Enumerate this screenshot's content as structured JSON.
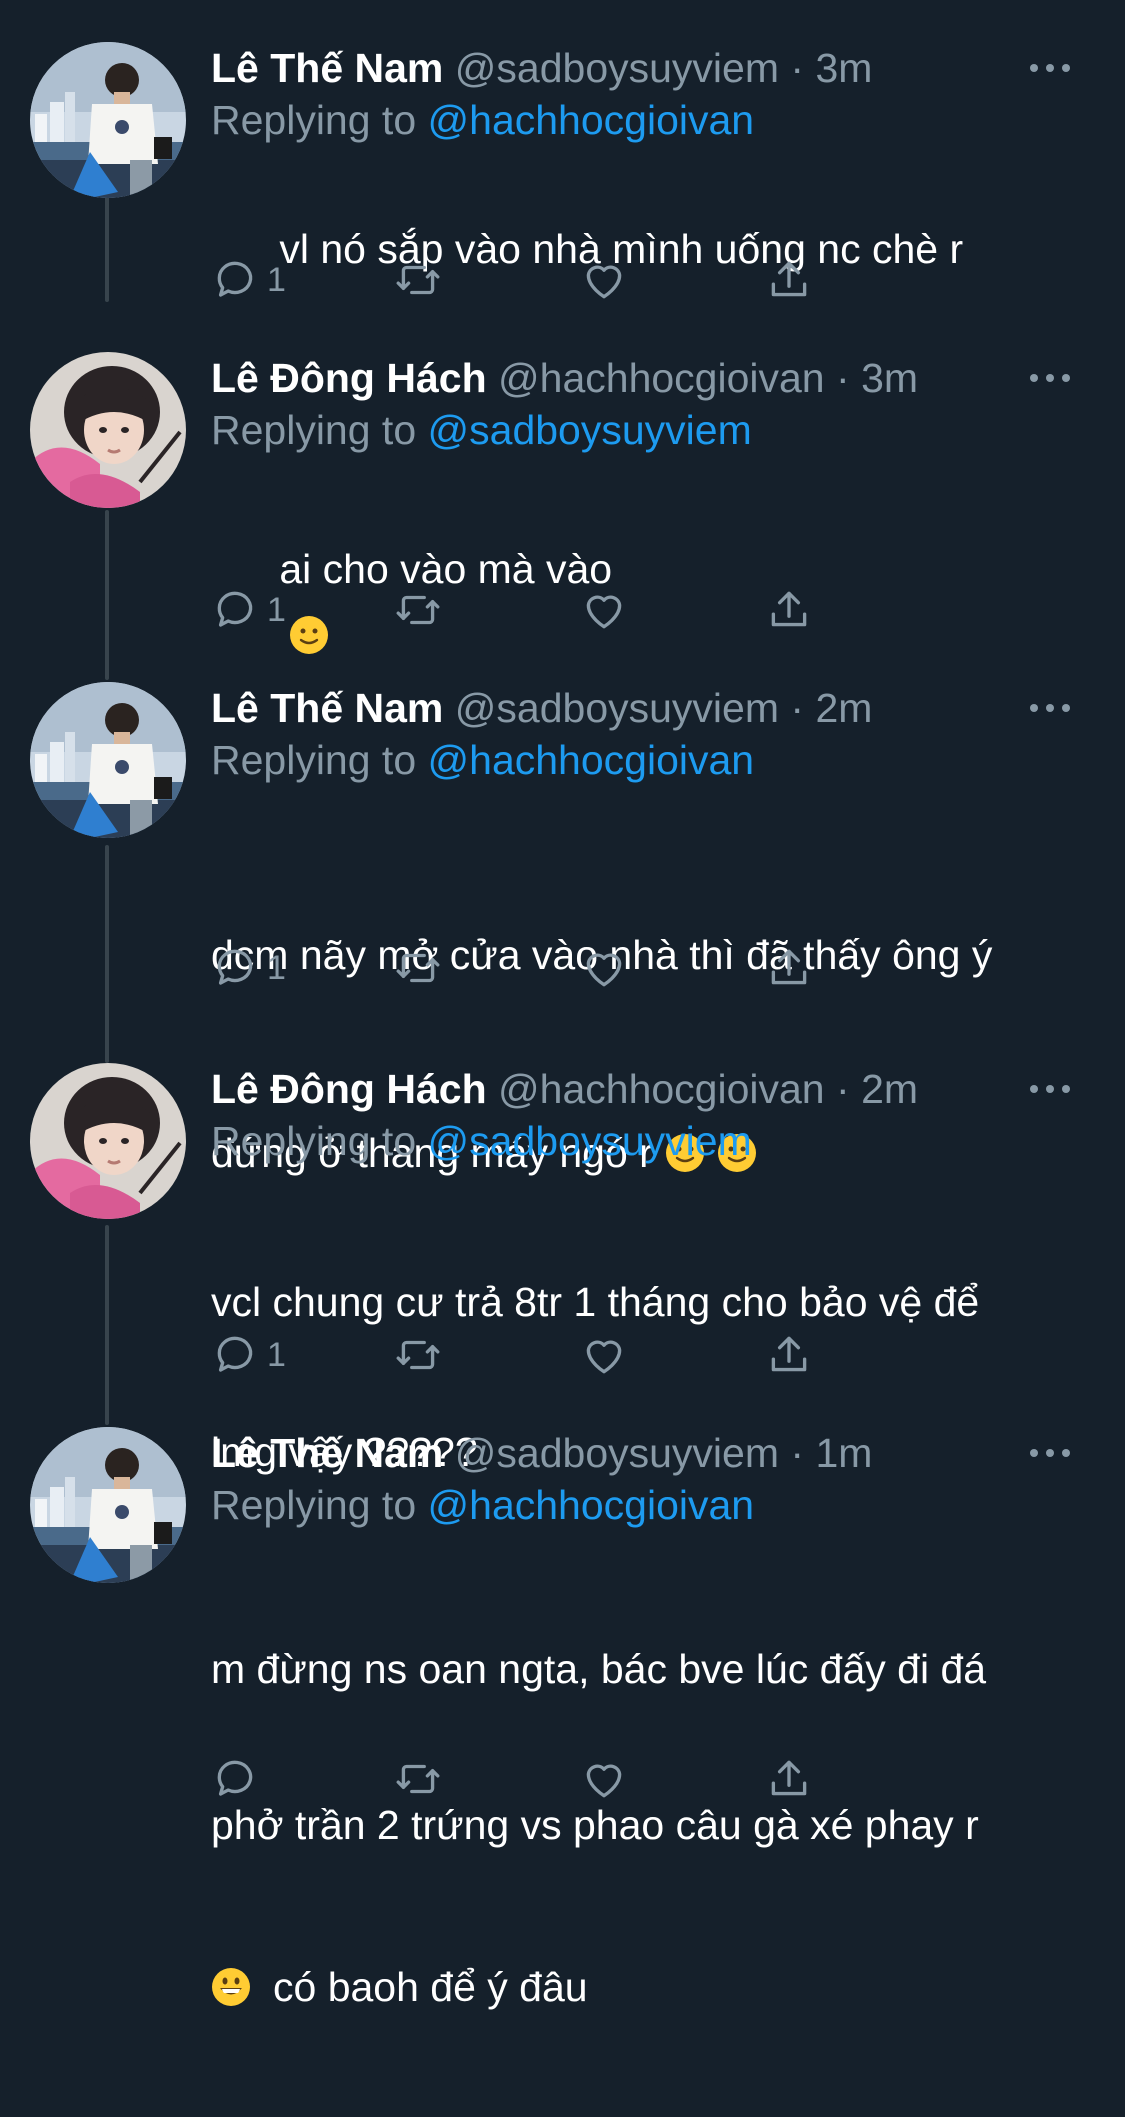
{
  "colors": {
    "background": "#15202b",
    "text_primary": "#ffffff",
    "text_secondary": "#8899a6",
    "link": "#1d9bf0",
    "thread_line": "#38444d"
  },
  "reply_prefix": "Replying to",
  "icons": {
    "reply": "reply-icon",
    "retweet": "retweet-icon",
    "like": "heart-icon",
    "share": "share-icon",
    "more": "more-dots-icon"
  },
  "tweets": [
    {
      "name": "Lê Thế Nam",
      "handle": "@sadboysuyviem",
      "separator": "·",
      "time": "3m",
      "replying_to": "@hachhocgioivan",
      "avatar": "avatar-nam",
      "text_lines": [
        "vl nó sắp vào nhà mình uống nc chè r"
      ],
      "reply_count": "1"
    },
    {
      "name": "Lê Đông Hách",
      "handle": "@hachhocgioivan",
      "separator": "·",
      "time": "3m",
      "replying_to": "@sadboysuyviem",
      "avatar": "avatar-hach",
      "text_lines": [
        "ai cho vào mà vào"
      ],
      "reply_count": "1"
    },
    {
      "name": "Lê Thế Nam",
      "handle": "@sadboysuyviem",
      "separator": "·",
      "time": "2m",
      "replying_to": "@hachhocgioivan",
      "avatar": "avatar-nam",
      "text_lines": [
        "dcm nãy mở cửa vào nhà thì đã thấy ông ý",
        "đứng ở thang máy ngó r"
      ],
      "reply_count": "1"
    },
    {
      "name": "Lê Đông Hách",
      "handle": "@hachhocgioivan",
      "separator": "·",
      "time": "2m",
      "replying_to": "@sadboysuyviem",
      "avatar": "avatar-hach",
      "text_lines": [
        "vcl chung cư trả 8tr 1 tháng cho bảo vệ để",
        "lmg vậy ?????"
      ],
      "reply_count": "1"
    },
    {
      "name": "Lê Thế Nam",
      "handle": "@sadboysuyviem",
      "separator": "·",
      "time": "1m",
      "replying_to": "@hachhocgioivan",
      "avatar": "avatar-nam",
      "text_lines": [
        "m đừng ns oan ngta, bác bve lúc đấy đi đá",
        "phở trần 2 trứng vs phao câu gà xé phay r",
        "có baoh để ý đâu"
      ],
      "reply_count": ""
    }
  ]
}
